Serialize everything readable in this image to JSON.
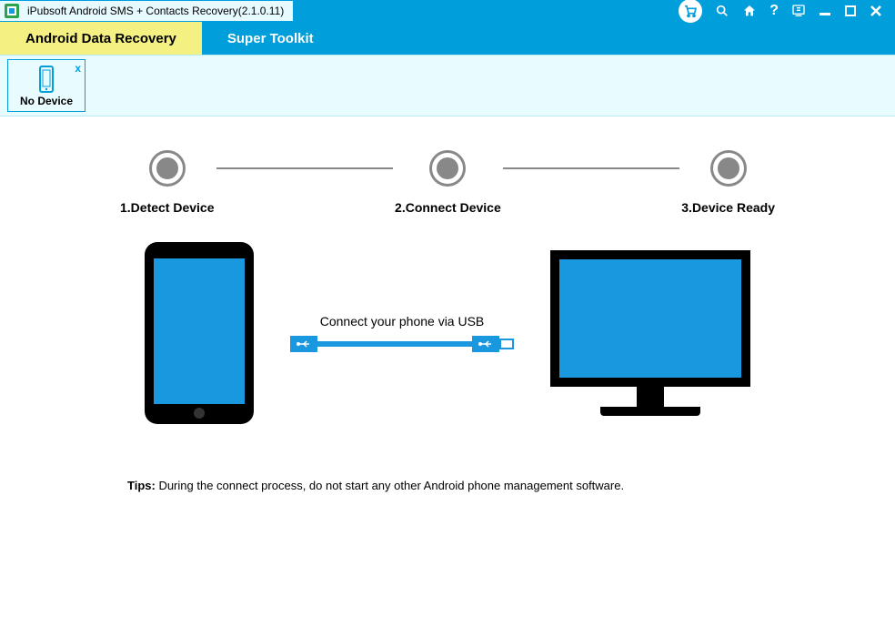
{
  "titlebar": {
    "app_title": "iPubsoft Android SMS + Contacts Recovery(2.1.0.11)"
  },
  "tabs": {
    "active": "Android Data Recovery",
    "inactive": "Super Toolkit"
  },
  "device_strip": {
    "no_device": "No Device",
    "close": "x"
  },
  "steps": {
    "s1": "1.Detect Device",
    "s2": "2.Connect Device",
    "s3": "3.Device Ready"
  },
  "cable": {
    "instruction": "Connect your phone via USB"
  },
  "tips": {
    "label": "Tips:",
    "text": " During the connect process, do not start any other Android phone management software."
  },
  "colors": {
    "primary": "#009edb",
    "accent_yellow": "#f4f082",
    "screen_blue": "#1998e0",
    "pale_blue": "#e8fcff"
  }
}
